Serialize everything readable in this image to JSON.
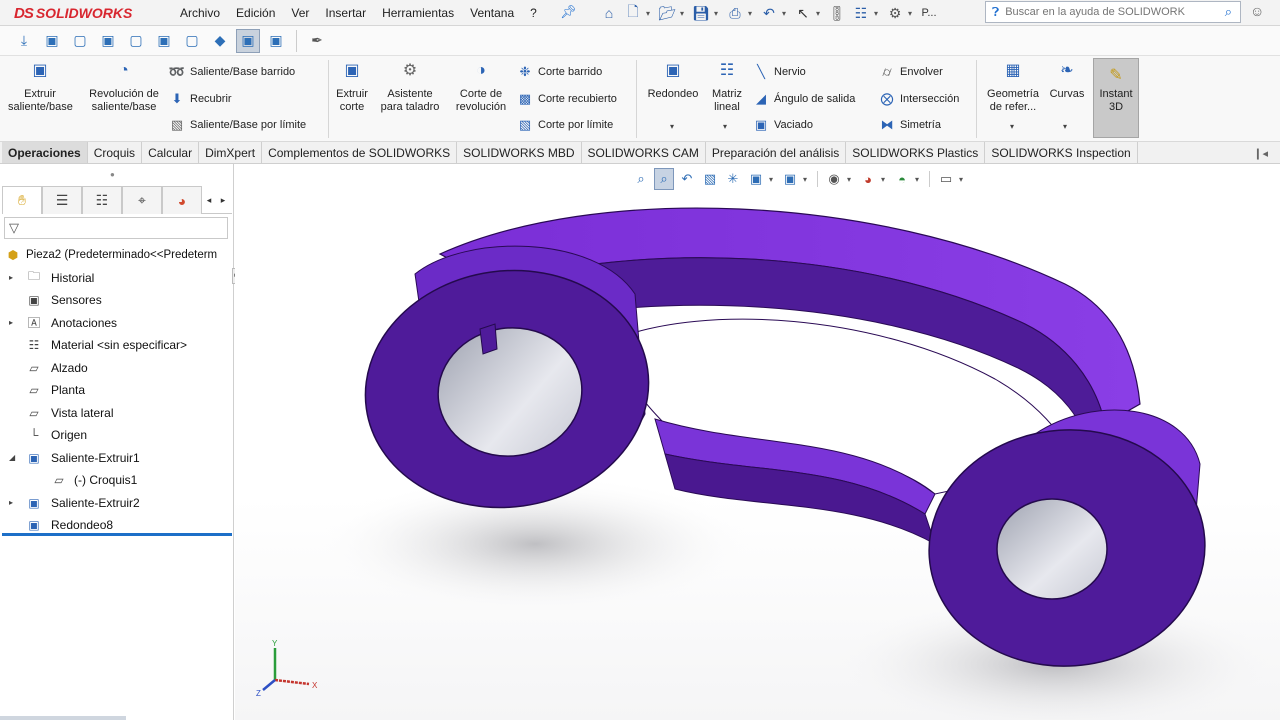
{
  "app": {
    "logo_ds": "DS",
    "logo_name": "SOLIDWORKS",
    "menu": [
      "Archivo",
      "Edición",
      "Ver",
      "Insertar",
      "Herramientas",
      "Ventana",
      "?"
    ],
    "search_placeholder": "Buscar en la ayuda de SOLIDWORKS",
    "user_label": "P..."
  },
  "ribbon": {
    "extrude": "Extruir saliente/base",
    "revolve": "Revolución de saliente/base",
    "swept": "Saliente/Base barrido",
    "loft": "Recubrir",
    "boundary": "Saliente/Base por límite",
    "extrude_cut": "Extruir corte",
    "hole_wizard": "Asistente para taladro",
    "revolve_cut": "Corte de revolución",
    "swept_cut": "Corte barrido",
    "loft_cut": "Corte recubierto",
    "boundary_cut": "Corte por límite",
    "fillet": "Redondeo",
    "linear_pattern": "Matriz lineal",
    "rib": "Nervio",
    "draft": "Ángulo de salida",
    "shell": "Vaciado",
    "wrap": "Envolver",
    "intersect": "Intersección",
    "mirror": "Simetría",
    "ref_geometry": "Geometría de refer...",
    "curves": "Curvas",
    "instant3d": "Instant 3D"
  },
  "tabs": [
    "Operaciones",
    "Croquis",
    "Calcular",
    "DimXpert",
    "Complementos de SOLIDWORKS",
    "SOLIDWORKS MBD",
    "SOLIDWORKS CAM",
    "Preparación del análisis",
    "SOLIDWORKS Plastics",
    "SOLIDWORKS Inspection"
  ],
  "tree": {
    "root": "Pieza2  (Predeterminado<<Predeterm",
    "items": [
      {
        "label": "Historial"
      },
      {
        "label": "Sensores"
      },
      {
        "label": "Anotaciones"
      },
      {
        "label": "Material <sin especificar>"
      },
      {
        "label": "Alzado"
      },
      {
        "label": "Planta"
      },
      {
        "label": "Vista lateral"
      },
      {
        "label": "Origen"
      },
      {
        "label": "Saliente-Extruir1"
      },
      {
        "label": "(-) Croquis1"
      },
      {
        "label": "Saliente-Extruir2"
      },
      {
        "label": "Redondeo8"
      }
    ]
  },
  "triad": {
    "x": "X",
    "y": "Y",
    "z": "Z"
  },
  "colors": {
    "part": "#5c1fb3",
    "accent": "#1d6fc8",
    "brand": "#d8262f"
  }
}
